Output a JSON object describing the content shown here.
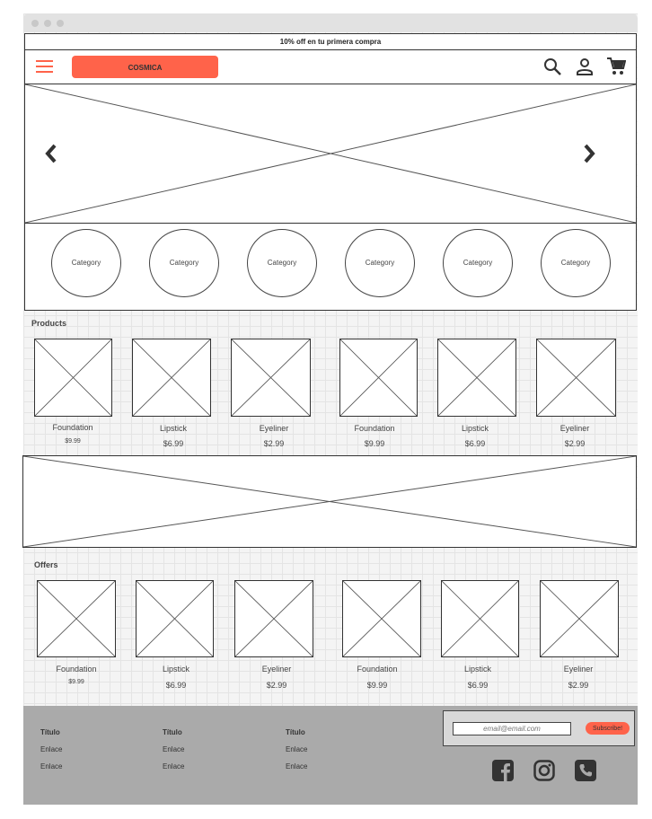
{
  "promo": {
    "text": "10% off en tu primera compra"
  },
  "header": {
    "logo": "COSMICA",
    "icons": [
      "menu-icon",
      "search-icon",
      "user-icon",
      "cart-icon"
    ],
    "accent": "#ff634a"
  },
  "hero": {
    "prev_icon": "chevron-left-icon",
    "next_icon": "chevron-right-icon"
  },
  "categories": [
    "Category",
    "Category",
    "Category",
    "Category",
    "Category",
    "Category"
  ],
  "products": {
    "title": "Products",
    "items": [
      {
        "name": "Foundation",
        "price": "$9.99"
      },
      {
        "name": "Lipstick",
        "price": "$6.99"
      },
      {
        "name": "Eyeliner",
        "price": "$2.99"
      },
      {
        "name": "Foundation",
        "price": "$9.99"
      },
      {
        "name": "Lipstick",
        "price": "$6.99"
      },
      {
        "name": "Eyeliner",
        "price": "$2.99"
      }
    ]
  },
  "offers": {
    "title": "Offers",
    "items": [
      {
        "name": "Foundation",
        "price": "$9.99"
      },
      {
        "name": "Lipstick",
        "price": "$6.99"
      },
      {
        "name": "Eyeliner",
        "price": "$2.99"
      },
      {
        "name": "Foundation",
        "price": "$9.99"
      },
      {
        "name": "Lipstick",
        "price": "$6.99"
      },
      {
        "name": "Eyeliner",
        "price": "$2.99"
      }
    ]
  },
  "footer": {
    "columns": [
      {
        "title": "Título",
        "links": [
          "Enlace",
          "Enlace"
        ]
      },
      {
        "title": "Título",
        "links": [
          "Enlace",
          "Enlace"
        ]
      },
      {
        "title": "Título",
        "links": [
          "Enlace",
          "Enlace"
        ]
      }
    ],
    "newsletter": {
      "placeholder": "email@email.com",
      "button": "Subscribe!"
    },
    "social": [
      "facebook-icon",
      "instagram-icon",
      "phone-icon"
    ]
  }
}
